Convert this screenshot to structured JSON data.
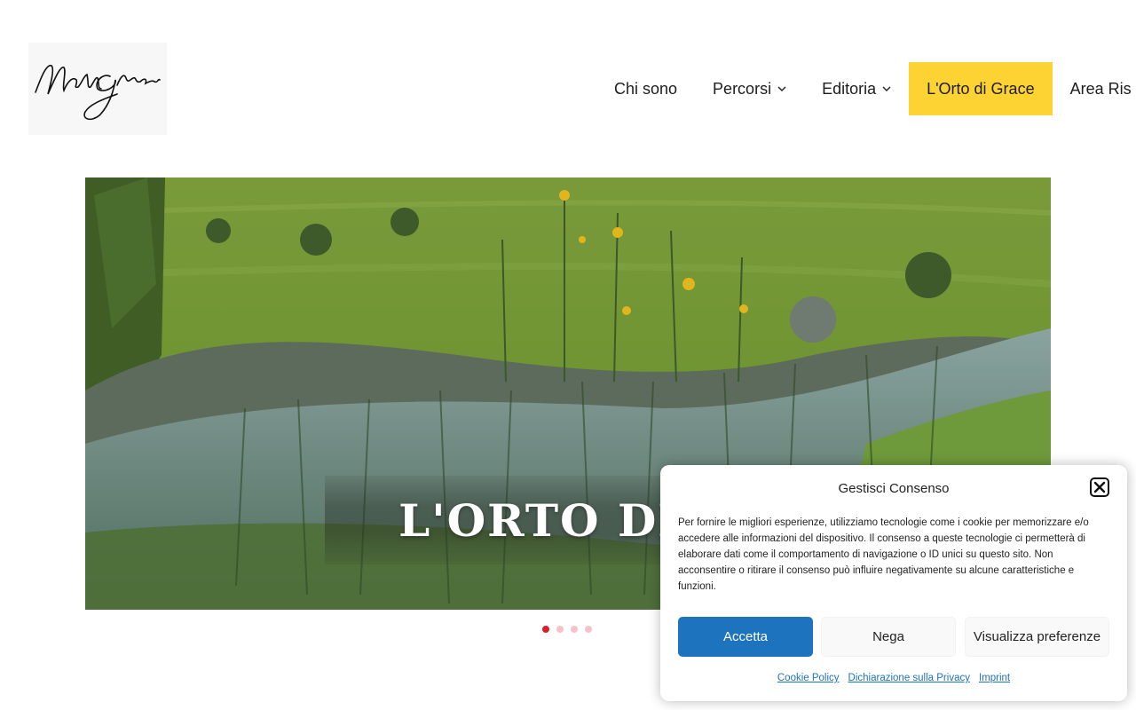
{
  "header": {
    "logo": {
      "icon": "signature-logo-icon",
      "signature_text": "Madi Grace"
    },
    "nav": [
      {
        "label": "Chi sono",
        "has_dropdown": false,
        "active": false
      },
      {
        "label": "Percorsi",
        "has_dropdown": true,
        "active": false
      },
      {
        "label": "Editoria",
        "has_dropdown": true,
        "active": false
      },
      {
        "label": "L'Orto di Grace",
        "has_dropdown": false,
        "active": true
      },
      {
        "label": "Area Ris",
        "has_dropdown": false,
        "active": false
      }
    ]
  },
  "slider": {
    "caption": "L'ORTO DI G",
    "dots": {
      "count": 4,
      "active_index": 0
    }
  },
  "cookie_banner": {
    "title": "Gestisci Consenso",
    "text": "Per fornire le migliori esperienze, utilizziamo tecnologie come i cookie per memorizzare e/o accedere alle informazioni del dispositivo. Il consenso a queste tecnologie ci permetterà di elaborare dati come il comportamento di navigazione o ID unici su questo sito. Non acconsentire o ritirare il consenso può influire negativamente su alcune caratteristiche e funzioni.",
    "accept_label": "Accetta",
    "deny_label": "Nega",
    "preferences_label": "Visualizza preferenze",
    "links": [
      "Cookie Policy",
      "Dichiarazione sulla Privacy",
      "Imprint"
    ]
  },
  "colors": {
    "accent_yellow": "#fdd333",
    "button_blue": "#1e73be",
    "dot_active": "#d9202f",
    "dot_inactive": "#f3c3c8"
  }
}
